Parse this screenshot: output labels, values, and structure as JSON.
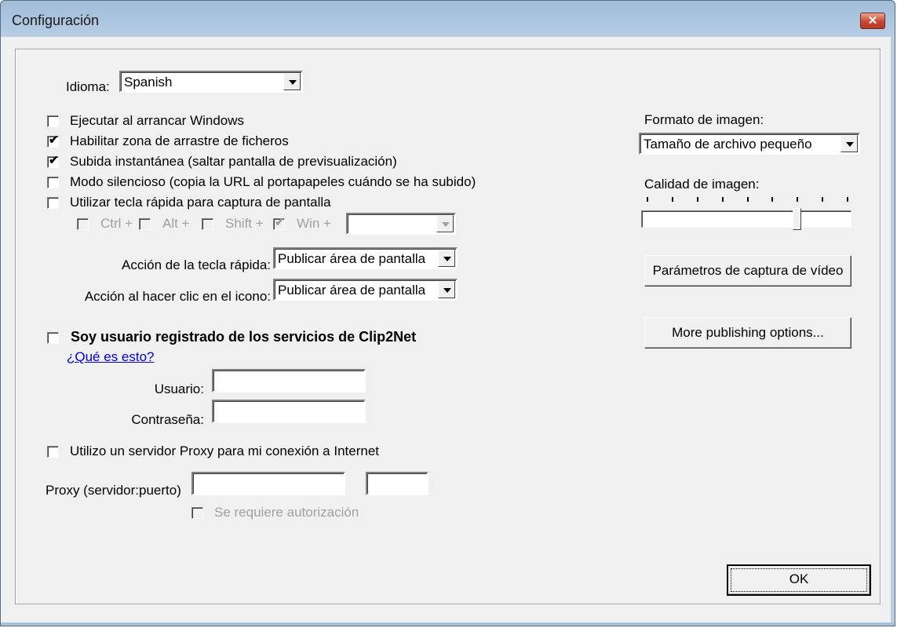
{
  "window": {
    "title": "Configuración",
    "close_label": "✕"
  },
  "language": {
    "label": "Idioma:",
    "value": "Spanish"
  },
  "options": [
    {
      "label": "Ejecutar al arrancar Windows",
      "checked": false
    },
    {
      "label": "Habilitar zona de arrastre de ficheros",
      "checked": true
    },
    {
      "label": "Subida instantánea (saltar pantalla de previsualización)",
      "checked": true
    },
    {
      "label": "Modo silencioso (copia la URL al portapapeles cuándo se ha subido)",
      "checked": false
    },
    {
      "label": "Utilizar tecla rápida para captura de pantalla",
      "checked": false
    }
  ],
  "hotkey_modifiers": [
    {
      "label": "Ctrl +",
      "checked": false
    },
    {
      "label": "Alt +",
      "checked": false
    },
    {
      "label": "Shift +",
      "checked": false
    },
    {
      "label": "Win +",
      "checked": true
    }
  ],
  "hotkey_key": {
    "value": ""
  },
  "hotkey_action": {
    "label": "Acción de la tecla rápida:",
    "value": "Publicar área de pantalla"
  },
  "icon_action": {
    "label": "Acción al hacer clic en el icono:",
    "value": "Publicar área de pantalla"
  },
  "registered": {
    "label": "Soy usuario registrado de los servicios de Clip2Net",
    "checked": false,
    "help_link": "¿Qué es esto?"
  },
  "user": {
    "label": "Usuario:",
    "value": ""
  },
  "password": {
    "label": "Contraseña:",
    "value": ""
  },
  "proxy": {
    "use_label": "Utilizo un servidor Proxy para mi conexión a Internet",
    "use_checked": false,
    "label": "Proxy (servidor:puerto)",
    "server": "",
    "port": "",
    "auth_label": "Se requiere autorización",
    "auth_checked": false
  },
  "image_format": {
    "label": "Formato de imagen:",
    "value": "Tamaño de archivo pequeño"
  },
  "image_quality": {
    "label": "Calidad de imagen:",
    "min": 0,
    "max": 8,
    "value": 6
  },
  "buttons": {
    "video_params": "Parámetros de captura de vídeo",
    "more_publishing": "More publishing options...",
    "ok": "OK"
  },
  "check_glyph": "✔"
}
